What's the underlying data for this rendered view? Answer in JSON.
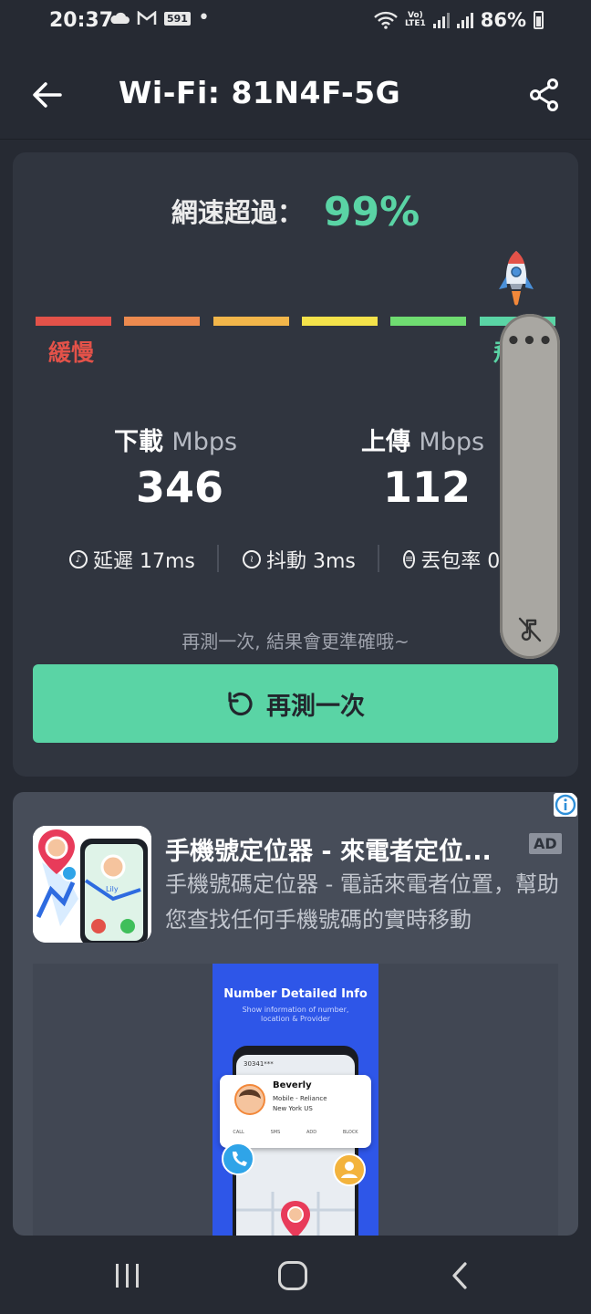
{
  "status_bar": {
    "time": "20:37",
    "left_icons": [
      "cloud-icon",
      "gmail-icon",
      "app-591-icon",
      "dot-icon"
    ],
    "badge_591": "591",
    "lte_top": "Vo)",
    "lte_bottom": "LTE1",
    "battery": "86%"
  },
  "header": {
    "title": "Wi-Fi: 81N4F-5G",
    "back_icon": "arrow-left-icon",
    "share_icon": "share-icon"
  },
  "result": {
    "exceed_label": "網速超過：",
    "exceed_value": "99%",
    "scale_colors": [
      "#e35249",
      "#ec8a4f",
      "#f2b64a",
      "#f4e24a",
      "#6fdc71",
      "#5ad4a5"
    ],
    "slow_label": "緩慢",
    "fast_label": "飛",
    "download_label": "下載",
    "download_unit": "Mbps",
    "download_value": "346",
    "upload_label": "上傳",
    "upload_unit": "Mbps",
    "upload_value": "112",
    "latency_label": "延遲 17ms",
    "jitter_label": "抖動 3ms",
    "loss_label": "丟包率 0",
    "hint": "再測一次, 結果會更準確哦~",
    "retry_label": "再測一次"
  },
  "floater": {
    "menu_icon": "more-dots-icon",
    "mute_icon": "mute-icon"
  },
  "ad": {
    "title": "手機號定位器 - 來電者定位...",
    "badge": "AD",
    "description": "手機號碼定位器 - 電話來電者位置，幫助您查找任何手機號碼的實時移動",
    "info_icon": "info-icon",
    "icon_caller_name": "Lily",
    "shot_title": "Number Detailed Info",
    "shot_subtitle": "Show information of number, location & Provider",
    "shot_number": "30341***",
    "shot_name": "Beverly",
    "shot_carrier": "Mobile - Reliance",
    "shot_location": "New York US",
    "shot_actions": [
      "CALL",
      "SMS",
      "ADD",
      "BLOCK"
    ]
  },
  "nav": {
    "recent_icon": "recent-apps-icon",
    "home_icon": "home-icon",
    "back_icon": "nav-back-icon"
  }
}
